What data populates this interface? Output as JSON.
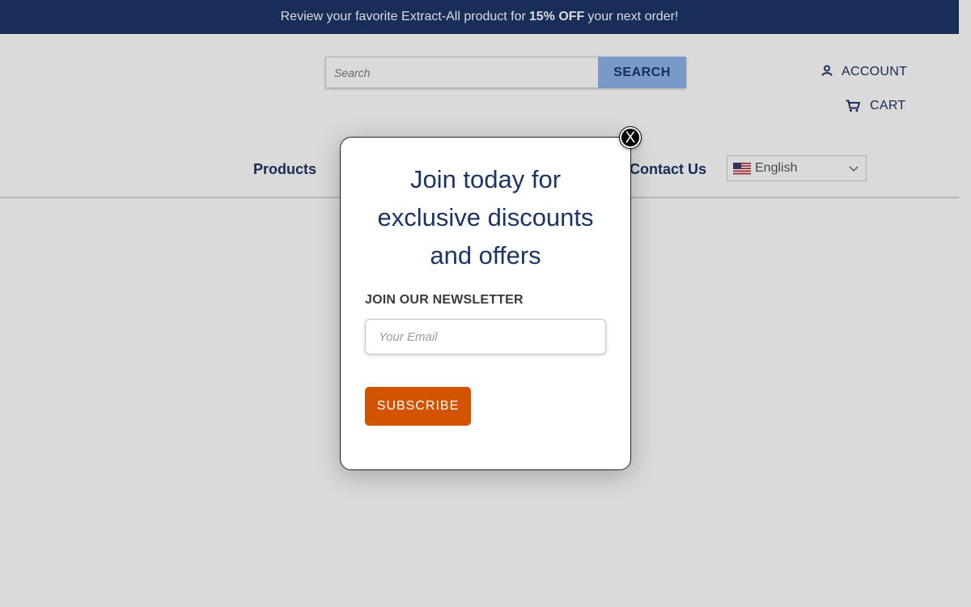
{
  "promo_bar": {
    "text_before": "Review your favorite Extract-All product for",
    "highlight": "15% OFF",
    "text_after": "your next order!"
  },
  "search": {
    "placeholder": "Search",
    "button_label": "SEARCH"
  },
  "account": {
    "label": "ACCOUNT",
    "icon": "user-icon"
  },
  "cart": {
    "label": "CART",
    "icon": "cart-icon"
  },
  "nav": {
    "products": "Products",
    "contact": "Contact Us"
  },
  "language": {
    "selected": "English",
    "flag": "us-flag-icon"
  },
  "modal": {
    "title_lines": [
      "Join today for",
      "exclusive discounts",
      "and offers"
    ],
    "newsletter_label": "JOIN OUR NEWSLETTER",
    "email_placeholder": "Your Email",
    "subscribe_label": "SUBSCRIBE",
    "close_label": "X"
  },
  "colors": {
    "brand_navy": "#1d3566",
    "search_button": "#8eb3ec",
    "subscribe_orange": "#d35400"
  }
}
